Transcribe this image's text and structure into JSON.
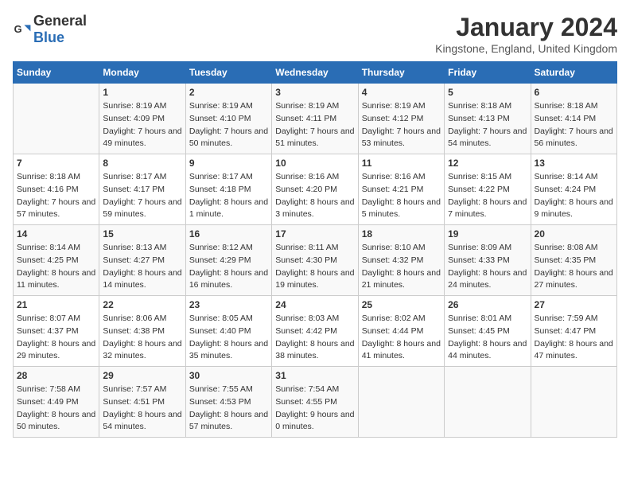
{
  "logo": {
    "general": "General",
    "blue": "Blue"
  },
  "header": {
    "title": "January 2024",
    "subtitle": "Kingstone, England, United Kingdom"
  },
  "weekdays": [
    "Sunday",
    "Monday",
    "Tuesday",
    "Wednesday",
    "Thursday",
    "Friday",
    "Saturday"
  ],
  "weeks": [
    [
      {
        "num": "",
        "sunrise": "",
        "sunset": "",
        "daylight": ""
      },
      {
        "num": "1",
        "sunrise": "Sunrise: 8:19 AM",
        "sunset": "Sunset: 4:09 PM",
        "daylight": "Daylight: 7 hours and 49 minutes."
      },
      {
        "num": "2",
        "sunrise": "Sunrise: 8:19 AM",
        "sunset": "Sunset: 4:10 PM",
        "daylight": "Daylight: 7 hours and 50 minutes."
      },
      {
        "num": "3",
        "sunrise": "Sunrise: 8:19 AM",
        "sunset": "Sunset: 4:11 PM",
        "daylight": "Daylight: 7 hours and 51 minutes."
      },
      {
        "num": "4",
        "sunrise": "Sunrise: 8:19 AM",
        "sunset": "Sunset: 4:12 PM",
        "daylight": "Daylight: 7 hours and 53 minutes."
      },
      {
        "num": "5",
        "sunrise": "Sunrise: 8:18 AM",
        "sunset": "Sunset: 4:13 PM",
        "daylight": "Daylight: 7 hours and 54 minutes."
      },
      {
        "num": "6",
        "sunrise": "Sunrise: 8:18 AM",
        "sunset": "Sunset: 4:14 PM",
        "daylight": "Daylight: 7 hours and 56 minutes."
      }
    ],
    [
      {
        "num": "7",
        "sunrise": "Sunrise: 8:18 AM",
        "sunset": "Sunset: 4:16 PM",
        "daylight": "Daylight: 7 hours and 57 minutes."
      },
      {
        "num": "8",
        "sunrise": "Sunrise: 8:17 AM",
        "sunset": "Sunset: 4:17 PM",
        "daylight": "Daylight: 7 hours and 59 minutes."
      },
      {
        "num": "9",
        "sunrise": "Sunrise: 8:17 AM",
        "sunset": "Sunset: 4:18 PM",
        "daylight": "Daylight: 8 hours and 1 minute."
      },
      {
        "num": "10",
        "sunrise": "Sunrise: 8:16 AM",
        "sunset": "Sunset: 4:20 PM",
        "daylight": "Daylight: 8 hours and 3 minutes."
      },
      {
        "num": "11",
        "sunrise": "Sunrise: 8:16 AM",
        "sunset": "Sunset: 4:21 PM",
        "daylight": "Daylight: 8 hours and 5 minutes."
      },
      {
        "num": "12",
        "sunrise": "Sunrise: 8:15 AM",
        "sunset": "Sunset: 4:22 PM",
        "daylight": "Daylight: 8 hours and 7 minutes."
      },
      {
        "num": "13",
        "sunrise": "Sunrise: 8:14 AM",
        "sunset": "Sunset: 4:24 PM",
        "daylight": "Daylight: 8 hours and 9 minutes."
      }
    ],
    [
      {
        "num": "14",
        "sunrise": "Sunrise: 8:14 AM",
        "sunset": "Sunset: 4:25 PM",
        "daylight": "Daylight: 8 hours and 11 minutes."
      },
      {
        "num": "15",
        "sunrise": "Sunrise: 8:13 AM",
        "sunset": "Sunset: 4:27 PM",
        "daylight": "Daylight: 8 hours and 14 minutes."
      },
      {
        "num": "16",
        "sunrise": "Sunrise: 8:12 AM",
        "sunset": "Sunset: 4:29 PM",
        "daylight": "Daylight: 8 hours and 16 minutes."
      },
      {
        "num": "17",
        "sunrise": "Sunrise: 8:11 AM",
        "sunset": "Sunset: 4:30 PM",
        "daylight": "Daylight: 8 hours and 19 minutes."
      },
      {
        "num": "18",
        "sunrise": "Sunrise: 8:10 AM",
        "sunset": "Sunset: 4:32 PM",
        "daylight": "Daylight: 8 hours and 21 minutes."
      },
      {
        "num": "19",
        "sunrise": "Sunrise: 8:09 AM",
        "sunset": "Sunset: 4:33 PM",
        "daylight": "Daylight: 8 hours and 24 minutes."
      },
      {
        "num": "20",
        "sunrise": "Sunrise: 8:08 AM",
        "sunset": "Sunset: 4:35 PM",
        "daylight": "Daylight: 8 hours and 27 minutes."
      }
    ],
    [
      {
        "num": "21",
        "sunrise": "Sunrise: 8:07 AM",
        "sunset": "Sunset: 4:37 PM",
        "daylight": "Daylight: 8 hours and 29 minutes."
      },
      {
        "num": "22",
        "sunrise": "Sunrise: 8:06 AM",
        "sunset": "Sunset: 4:38 PM",
        "daylight": "Daylight: 8 hours and 32 minutes."
      },
      {
        "num": "23",
        "sunrise": "Sunrise: 8:05 AM",
        "sunset": "Sunset: 4:40 PM",
        "daylight": "Daylight: 8 hours and 35 minutes."
      },
      {
        "num": "24",
        "sunrise": "Sunrise: 8:03 AM",
        "sunset": "Sunset: 4:42 PM",
        "daylight": "Daylight: 8 hours and 38 minutes."
      },
      {
        "num": "25",
        "sunrise": "Sunrise: 8:02 AM",
        "sunset": "Sunset: 4:44 PM",
        "daylight": "Daylight: 8 hours and 41 minutes."
      },
      {
        "num": "26",
        "sunrise": "Sunrise: 8:01 AM",
        "sunset": "Sunset: 4:45 PM",
        "daylight": "Daylight: 8 hours and 44 minutes."
      },
      {
        "num": "27",
        "sunrise": "Sunrise: 7:59 AM",
        "sunset": "Sunset: 4:47 PM",
        "daylight": "Daylight: 8 hours and 47 minutes."
      }
    ],
    [
      {
        "num": "28",
        "sunrise": "Sunrise: 7:58 AM",
        "sunset": "Sunset: 4:49 PM",
        "daylight": "Daylight: 8 hours and 50 minutes."
      },
      {
        "num": "29",
        "sunrise": "Sunrise: 7:57 AM",
        "sunset": "Sunset: 4:51 PM",
        "daylight": "Daylight: 8 hours and 54 minutes."
      },
      {
        "num": "30",
        "sunrise": "Sunrise: 7:55 AM",
        "sunset": "Sunset: 4:53 PM",
        "daylight": "Daylight: 8 hours and 57 minutes."
      },
      {
        "num": "31",
        "sunrise": "Sunrise: 7:54 AM",
        "sunset": "Sunset: 4:55 PM",
        "daylight": "Daylight: 9 hours and 0 minutes."
      },
      {
        "num": "",
        "sunrise": "",
        "sunset": "",
        "daylight": ""
      },
      {
        "num": "",
        "sunrise": "",
        "sunset": "",
        "daylight": ""
      },
      {
        "num": "",
        "sunrise": "",
        "sunset": "",
        "daylight": ""
      }
    ]
  ]
}
